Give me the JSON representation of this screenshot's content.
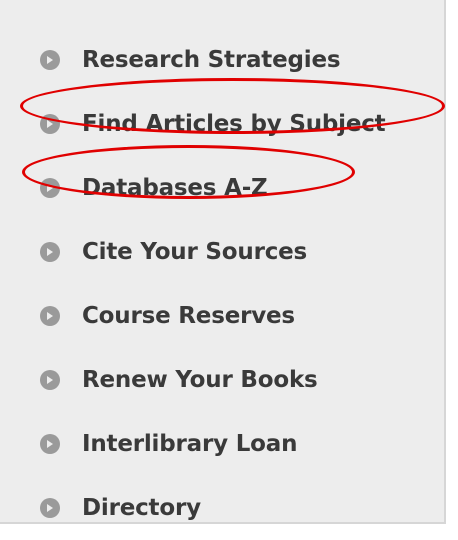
{
  "menu": {
    "items": [
      {
        "label": "Research Strategies"
      },
      {
        "label": "Find Articles by Subject"
      },
      {
        "label": "Databases A-Z"
      },
      {
        "label": "Cite Your Sources"
      },
      {
        "label": "Course Reserves"
      },
      {
        "label": "Renew Your Books"
      },
      {
        "label": "Interlibrary Loan"
      },
      {
        "label": "Directory"
      }
    ]
  },
  "icons": {
    "bullet": "chevron-right-circle-icon"
  },
  "colors": {
    "panel_background": "#ededed",
    "text": "#3a3a3a",
    "bullet": "#9a9a9a",
    "annotation": "#e00000"
  }
}
